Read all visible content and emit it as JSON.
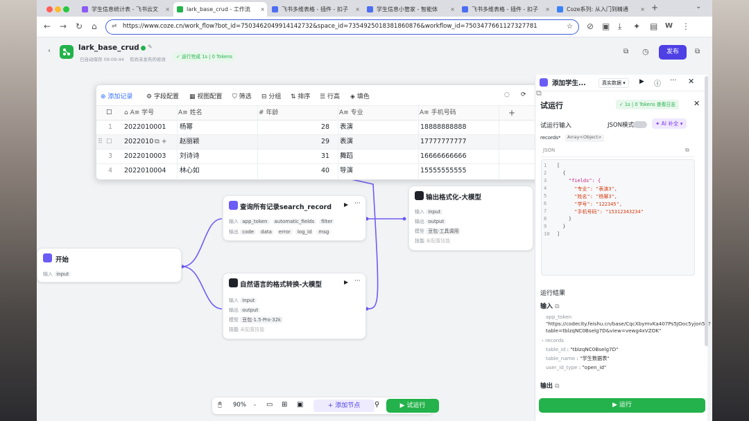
{
  "browser": {
    "tabs": [
      {
        "label": "学生信息统计表 - 飞书云文",
        "color": "#8b5cf6"
      },
      {
        "label": "lark_base_crud - 工作流",
        "color": "#23b24b"
      },
      {
        "label": "飞书多维表格 - 插件 - 扣子",
        "color": "#4e6ef2"
      },
      {
        "label": "学生信息小管家 - 智能体",
        "color": "#4e6ef2"
      },
      {
        "label": "飞书多维表格 - 插件 - 扣子",
        "color": "#4e6ef2"
      },
      {
        "label": "Coze系列: 从入门到精通",
        "color": "#3b82f6"
      }
    ],
    "url": "https://www.coze.cn/work_flow?bot_id=7503462049914142732&space_id=7354925018381860876&workflow_id=7503477661127327781",
    "profile_initial": "W"
  },
  "app": {
    "title": "lark_base_crud",
    "autosave": "已自动保存 09:09:44",
    "unpublished": "有尚未发布的修改",
    "run_status": "运行完成 1s | 0 Tokens",
    "publish_label": "发布"
  },
  "table": {
    "toolbar": [
      "添加记录",
      "字段配置",
      "视图配置",
      "筛选",
      "分组",
      "排序",
      "行高",
      "填色"
    ],
    "columns": [
      "学号",
      "姓名",
      "年龄",
      "专业",
      "手机号码"
    ],
    "rows": [
      {
        "idx": "1",
        "id": "2022010001",
        "name": "杨幂",
        "age": "28",
        "major": "表演",
        "phone": "18888888888"
      },
      {
        "idx": "",
        "id": "2022010",
        "name": "赵丽颖",
        "age": "29",
        "major": "表演",
        "phone": "17777777777"
      },
      {
        "idx": "3",
        "id": "2022010003",
        "name": "刘诗诗",
        "age": "31",
        "major": "舞蹈",
        "phone": "16666666666"
      },
      {
        "idx": "4",
        "id": "2022010004",
        "name": "林心如",
        "age": "40",
        "major": "导演",
        "phone": "15555555555"
      }
    ],
    "add_col": "+"
  },
  "nodes": {
    "start": {
      "title": "开始",
      "input_label": "输入",
      "input": "input"
    },
    "search": {
      "title": "查询所有记录search_record",
      "in_label": "输入",
      "inputs": [
        "app_token",
        "automatic_fields",
        "filter"
      ],
      "out_label": "输出",
      "outputs": [
        "code",
        "data",
        "error",
        "log_id",
        "msg"
      ]
    },
    "nlp": {
      "title": "自然语言的格式转换-大模型",
      "in_label": "输入",
      "input": "input",
      "out_label": "输出",
      "output": "output",
      "model_label": "模型",
      "model": "豆包·1.5·Pro·32k",
      "skill_label": "技能",
      "skill": "未配置技能"
    },
    "format": {
      "title": "输出格式化-大模型",
      "in_label": "输入",
      "input": "input",
      "out_label": "输出",
      "output": "output",
      "model_label": "模型",
      "model": "豆包·工具调用",
      "skill_label": "技能",
      "skill": "未配置技能"
    }
  },
  "panel_head": {
    "title": "添加学生...",
    "mode": "真实数据"
  },
  "run_panel": {
    "title": "试运行",
    "status": "1s | 0 Tokens",
    "status_link": "查看日志",
    "input_label": "试运行输入",
    "json_mode": "JSON模式",
    "ai_fill": "AI 补全",
    "records_label": "records*",
    "records_type": "Array<Object>",
    "json_label": "JSON",
    "code_lines": [
      {
        "n": "1",
        "t": "["
      },
      {
        "n": "2",
        "t": "  {"
      },
      {
        "n": "3",
        "t": "    \"fields\": {"
      },
      {
        "n": "4",
        "t": "      \"专业\": \"表演3\","
      },
      {
        "n": "5",
        "t": "      \"姓名\": \"杨幂3\","
      },
      {
        "n": "6",
        "t": "      \"学号\": \"122345\","
      },
      {
        "n": "7",
        "t": "      \"手机号码\": \"15312343234\""
      },
      {
        "n": "8",
        "t": "    }"
      },
      {
        "n": "9",
        "t": "  }"
      },
      {
        "n": "10",
        "t": "]"
      }
    ],
    "result_title": "运行结果",
    "input_section": "输入",
    "app_token_key": "app_token",
    "app_token_val": "\"https://codecity.feishu.cn/base/CqcXbymvKa407Ps5JOoc5yjon5d?table=tblzqNC0Bselg7D&view=vewg4xVZOK\"",
    "records_key": "records",
    "table_id_key": "table_id",
    "table_id_val": "\"tblzqNC0Bselg7D\"",
    "table_name_key": "table_name",
    "table_name_val": "\"学生数据表\"",
    "user_id_key": "user_id_type",
    "user_id_val": "\"open_id\"",
    "output_section": "输出",
    "run_button": "运行"
  },
  "bottom_bar": {
    "zoom": "90%",
    "add_node": "添加节点",
    "test_run": "试运行"
  },
  "colors": {
    "accent": "#4e40e5",
    "green": "#23b24b",
    "purple": "#6b5cf6"
  }
}
